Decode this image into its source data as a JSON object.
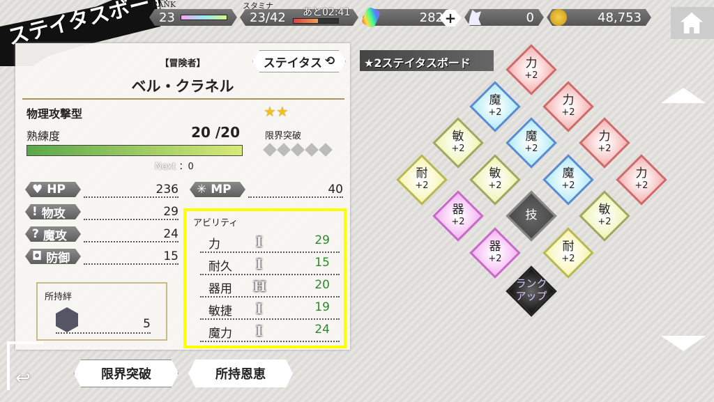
{
  "header": {
    "title": "ステイタスボード",
    "rank_label": "RANK",
    "rank": "23",
    "rank_progress": 1.0,
    "stamina_label": "スタミナ",
    "stamina": "23/42",
    "stamina_timer": "あと02:41",
    "stamina_fraction": 0.55,
    "gems": "282",
    "crystals": "0",
    "gold": "48,753",
    "icons": [
      "rainbow-crystal-icon",
      "plus-icon",
      "white-crystal-icon",
      "gold-coin-icon",
      "home-icon"
    ]
  },
  "character": {
    "title": "【冒険者】",
    "name": "ベル・クラネル",
    "status_button": "ステイタス",
    "type": "物理攻撃型",
    "stars": 2,
    "proficiency_label": "熟練度",
    "proficiency": "20 /20",
    "proficiency_fraction": 1.0,
    "next_label": "Next",
    "next_value": "：0",
    "limit_break_label": "限界突破",
    "limit_break_level": 0,
    "limit_break_max": 5
  },
  "stats": [
    {
      "label": "HP",
      "value": "236",
      "icon": "heart-icon"
    },
    {
      "label": "MP",
      "value": "40",
      "icon": "magic-book-icon"
    },
    {
      "label": "物攻",
      "value": "29",
      "icon": "sword-icon"
    },
    {
      "label": "魔攻",
      "value": "24",
      "icon": "staff-icon"
    },
    {
      "label": "防御",
      "value": "15",
      "icon": "shield-icon"
    }
  ],
  "bonds": {
    "label": "所持絆",
    "value": "5"
  },
  "ability": {
    "title": "アビリティ",
    "rows": [
      {
        "name": "力",
        "rank": "I",
        "value": "29"
      },
      {
        "name": "耐久",
        "rank": "I",
        "value": "15"
      },
      {
        "name": "器用",
        "rank": "H",
        "value": "20"
      },
      {
        "name": "敏捷",
        "rank": "I",
        "value": "19"
      },
      {
        "name": "魔力",
        "rank": "I",
        "value": "24"
      }
    ],
    "highlight_color": "#ffff00"
  },
  "board": {
    "title": "★2ステイタスボード",
    "nodes": [
      {
        "stat": "力",
        "bonus": "+2",
        "kind": "str"
      },
      {
        "stat": "魔",
        "bonus": "+2",
        "kind": "mag"
      },
      {
        "stat": "力",
        "bonus": "+2",
        "kind": "str"
      },
      {
        "stat": "敏",
        "bonus": "+2",
        "kind": "agi"
      },
      {
        "stat": "魔",
        "bonus": "+2",
        "kind": "mag"
      },
      {
        "stat": "力",
        "bonus": "+2",
        "kind": "str"
      },
      {
        "stat": "耐",
        "bonus": "+2",
        "kind": "end"
      },
      {
        "stat": "敏",
        "bonus": "+2",
        "kind": "agi"
      },
      {
        "stat": "魔",
        "bonus": "+2",
        "kind": "mag"
      },
      {
        "stat": "力",
        "bonus": "+2",
        "kind": "str"
      },
      {
        "stat": "器",
        "bonus": "+2",
        "kind": "dex"
      },
      {
        "stat": "技",
        "bonus": "",
        "kind": "skill"
      },
      {
        "stat": "敏",
        "bonus": "+2",
        "kind": "agi"
      },
      {
        "stat": "器",
        "bonus": "+2",
        "kind": "dex"
      },
      {
        "stat": "耐",
        "bonus": "+2",
        "kind": "end"
      },
      {
        "stat": "ランク\nアップ",
        "bonus": "",
        "kind": "rankup"
      }
    ],
    "colors": {
      "str": "#f7b3b3",
      "mag": "#b3ecf7",
      "agi": "#ecf5b0",
      "end": "#f7f5b0",
      "dex": "#f5b3f3",
      "skill": "#4a4a4a",
      "rankup": "#111111"
    }
  },
  "footer": {
    "limit_break_button": "限界突破",
    "blessings_button": "所持恩恵"
  }
}
